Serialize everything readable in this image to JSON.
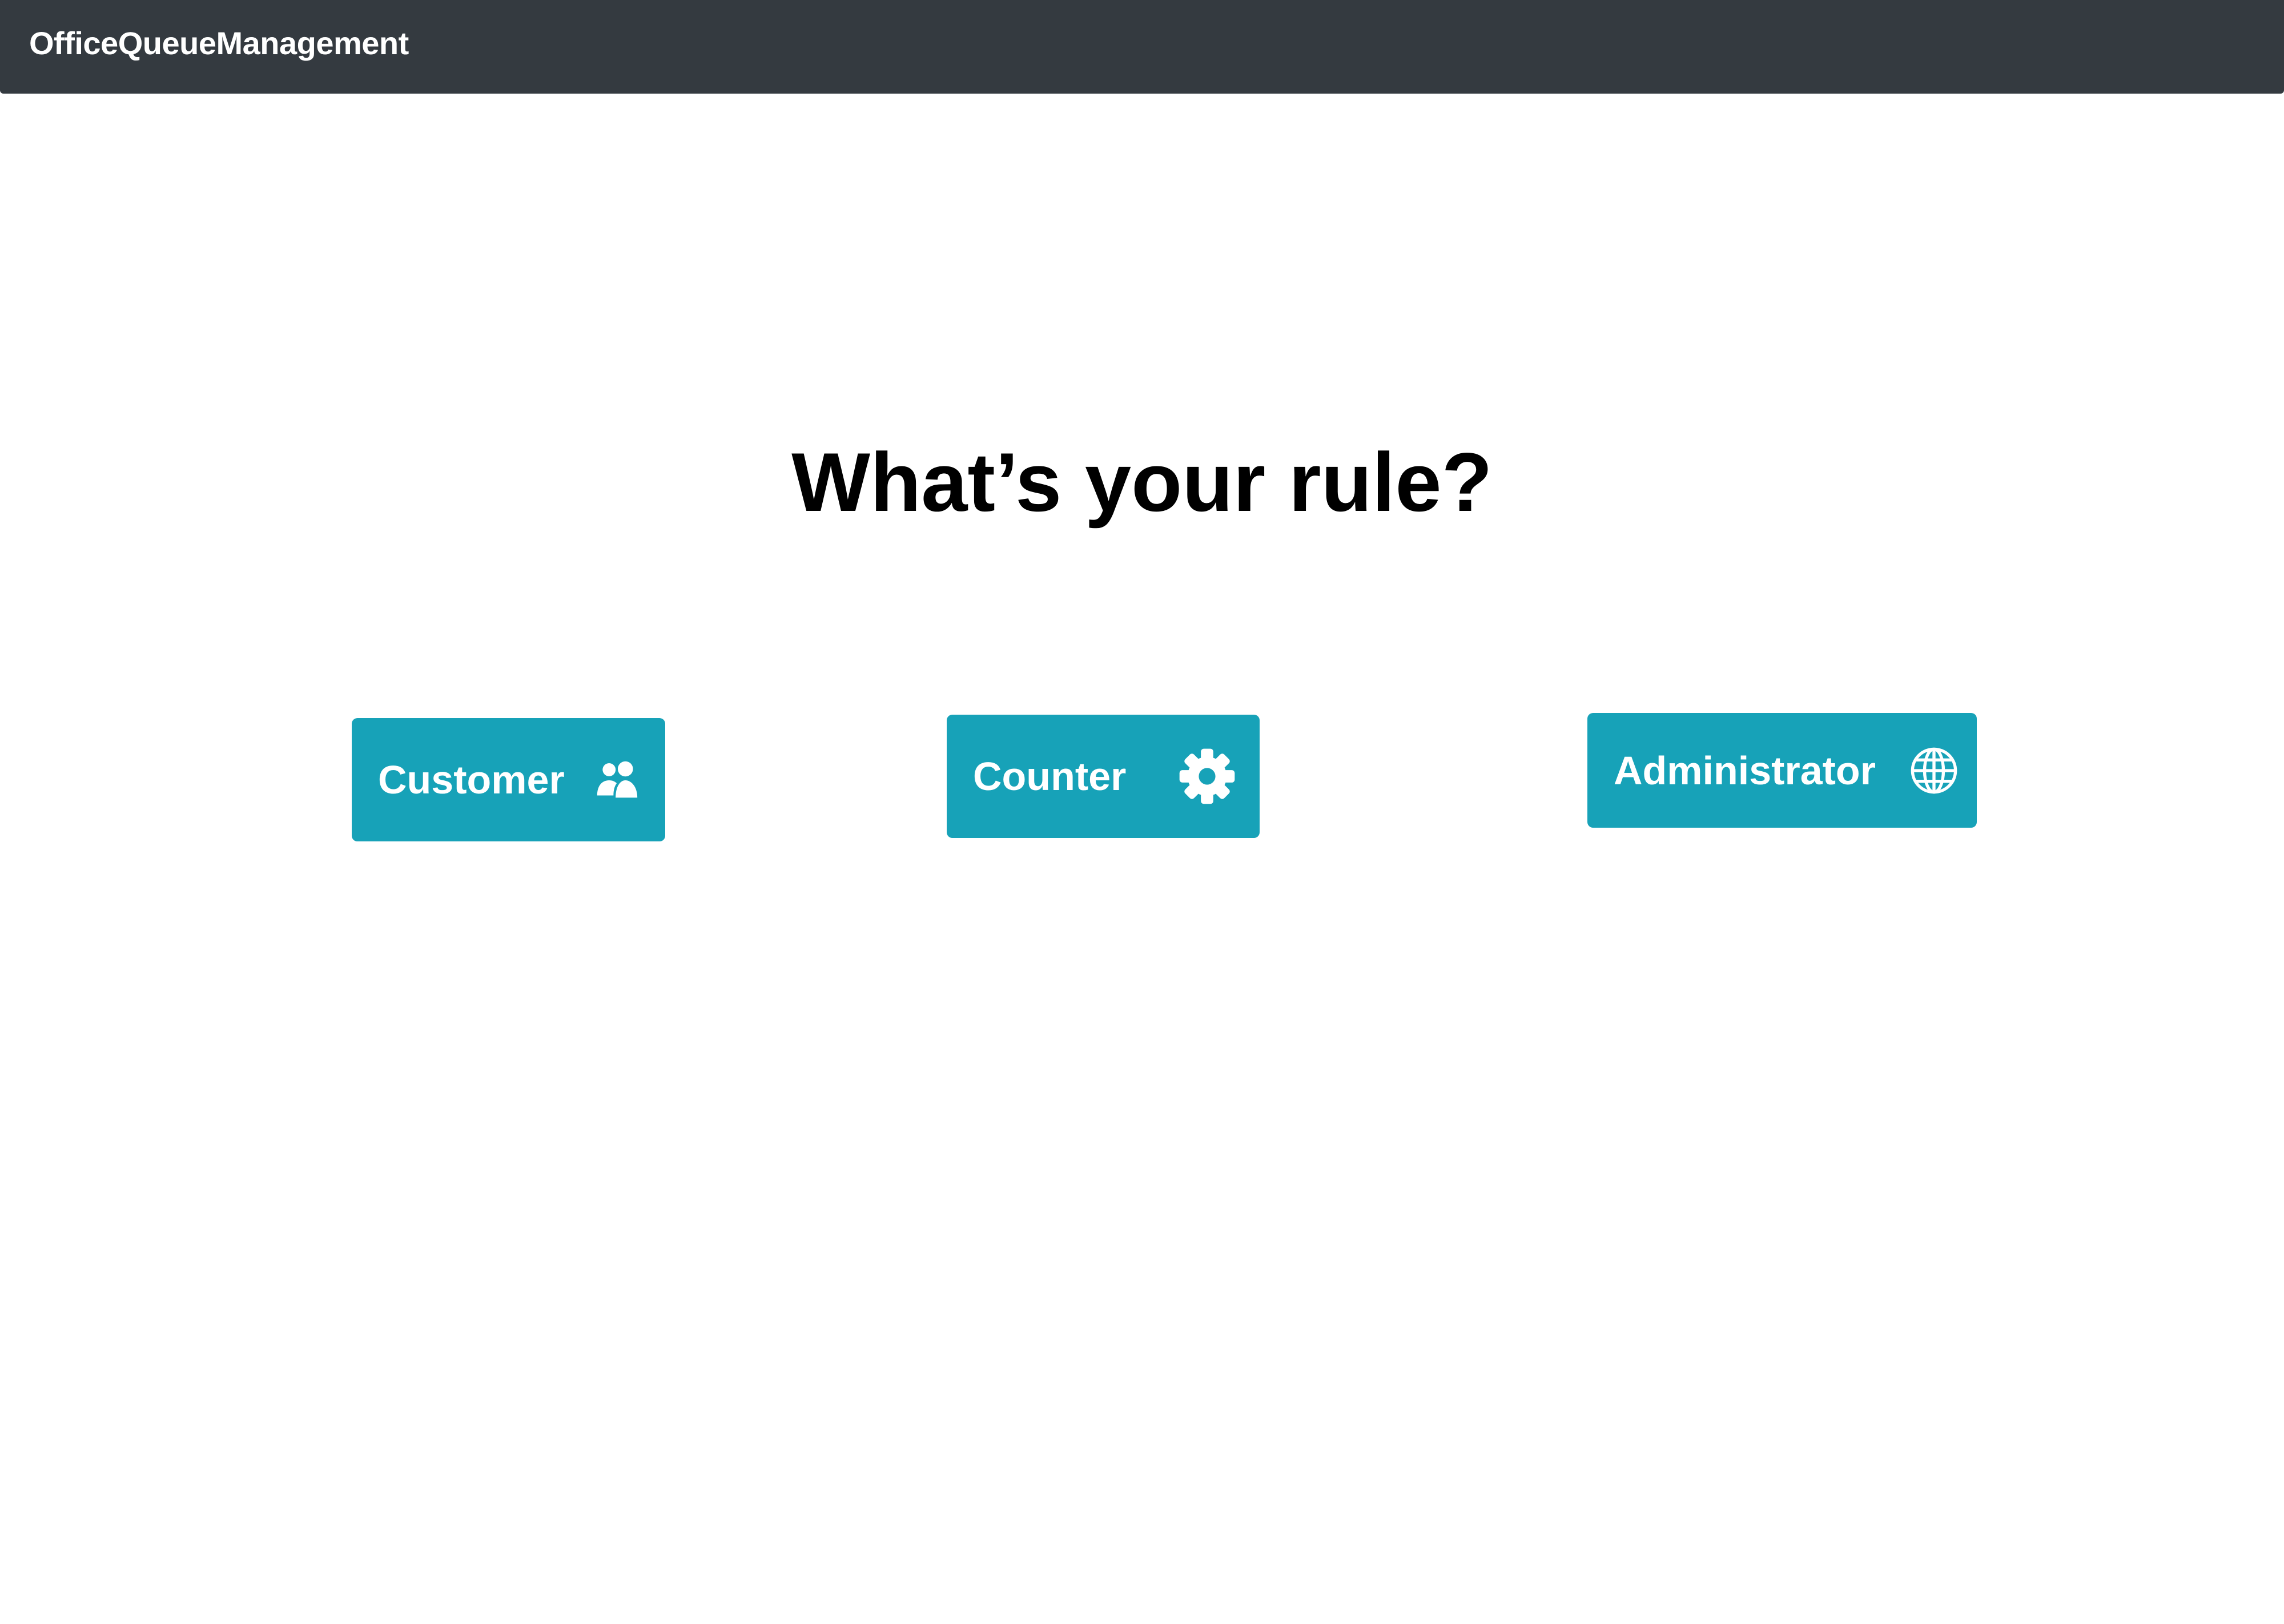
{
  "navbar": {
    "brand": "OfficeQueueManagement",
    "background": "#343a40"
  },
  "main": {
    "heading": "What’s your rule?"
  },
  "roles": [
    {
      "label": "Customer",
      "icon": "people-icon"
    },
    {
      "label": "Counter",
      "icon": "gear-icon"
    },
    {
      "label": "Administrator",
      "icon": "globe-icon"
    }
  ],
  "colors": {
    "button": "#17a2b8",
    "button_text": "#ffffff",
    "heading": "#000000"
  }
}
